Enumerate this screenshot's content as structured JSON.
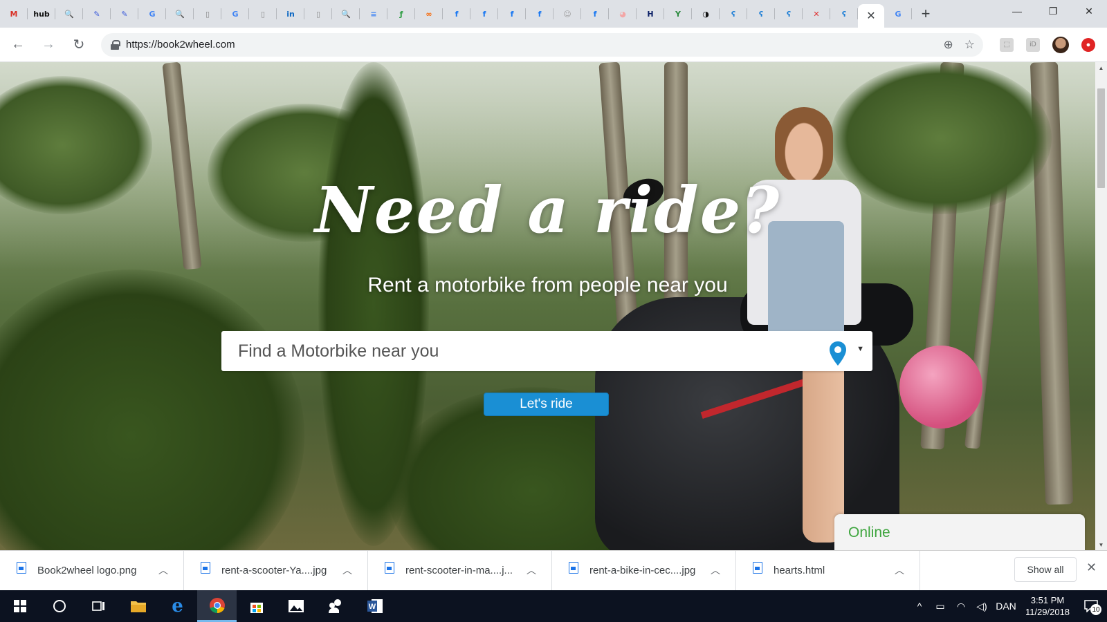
{
  "browser": {
    "tabs": [
      {
        "icon": "gmail-icon",
        "glyph": "M",
        "color": "#d93025"
      },
      {
        "icon": "hub-icon",
        "glyph": "hub",
        "color": "#111111"
      },
      {
        "icon": "search-magnifier-icon",
        "glyph": "🔍",
        "color": "#4a6fd8"
      },
      {
        "icon": "form-icon",
        "glyph": "✎",
        "color": "#3b5bdb"
      },
      {
        "icon": "form-icon",
        "glyph": "✎",
        "color": "#3b5bdb"
      },
      {
        "icon": "google-icon",
        "glyph": "G",
        "color": "#4285f4"
      },
      {
        "icon": "search-magnifier-icon",
        "glyph": "🔍",
        "color": "#4a6fd8"
      },
      {
        "icon": "document-icon",
        "glyph": "▯",
        "color": "#888888"
      },
      {
        "icon": "google-icon",
        "glyph": "G",
        "color": "#4285f4"
      },
      {
        "icon": "document-icon",
        "glyph": "▯",
        "color": "#888888"
      },
      {
        "icon": "linkedin-icon",
        "glyph": "in",
        "color": "#0a66c2"
      },
      {
        "icon": "document-icon",
        "glyph": "▯",
        "color": "#888888"
      },
      {
        "icon": "search-magnifier-icon",
        "glyph": "🔍",
        "color": "#4a6fd8"
      },
      {
        "icon": "docs-icon",
        "glyph": "≡",
        "color": "#4285f4"
      },
      {
        "icon": "feather-icon",
        "glyph": "ƒ",
        "color": "#2f9e44"
      },
      {
        "icon": "link-icon",
        "glyph": "∞",
        "color": "#f76707"
      },
      {
        "icon": "facebook-icon",
        "glyph": "f",
        "color": "#1877f2"
      },
      {
        "icon": "facebook-icon",
        "glyph": "f",
        "color": "#1877f2"
      },
      {
        "icon": "facebook-icon",
        "glyph": "f",
        "color": "#1877f2"
      },
      {
        "icon": "facebook-icon",
        "glyph": "f",
        "color": "#1877f2"
      },
      {
        "icon": "profile-icon",
        "glyph": "☺",
        "color": "#9e9e9e"
      },
      {
        "icon": "facebook-icon",
        "glyph": "f",
        "color": "#1877f2"
      },
      {
        "icon": "pig-icon",
        "glyph": "◕",
        "color": "#f3a6a6"
      },
      {
        "icon": "h-icon",
        "glyph": "H",
        "color": "#0b1f66"
      },
      {
        "icon": "plant-icon",
        "glyph": "Y",
        "color": "#2b8a3e"
      },
      {
        "icon": "swirl-icon",
        "glyph": "◑",
        "color": "#111111"
      },
      {
        "icon": "cyan-swoosh-icon",
        "glyph": "ʕ",
        "color": "#1c7ed6"
      },
      {
        "icon": "cyan-swoosh-icon",
        "glyph": "ʕ",
        "color": "#1c7ed6"
      },
      {
        "icon": "cyan-swoosh-icon",
        "glyph": "ʕ",
        "color": "#1c7ed6"
      },
      {
        "icon": "x-logo-icon",
        "glyph": "✕",
        "color": "#e03131"
      },
      {
        "icon": "cyan-swoosh-icon",
        "glyph": "ʕ",
        "color": "#1c7ed6"
      }
    ],
    "active_tab_close": "✕",
    "after_tab_icon": {
      "icon": "google-icon",
      "glyph": "G",
      "color": "#4285f4"
    },
    "new_tab": "+",
    "window_controls": {
      "minimize": "—",
      "restore": "❐",
      "close": "✕"
    },
    "url": "https://book2wheel.com"
  },
  "hero": {
    "title": "Need a ride?",
    "subtitle": "Rent a motorbike from people near you",
    "search_placeholder": "Find a Motorbike near you",
    "button": "Let's ride",
    "chat_status": "Online",
    "accent": "#1a8fd4",
    "online_color": "#3ea53e"
  },
  "downloads": {
    "items": [
      {
        "name": "Book2wheel logo.png"
      },
      {
        "name": "rent-a-scooter-Ya....jpg"
      },
      {
        "name": "rent-scooter-in-ma....j..."
      },
      {
        "name": "rent-a-bike-in-cec....jpg"
      },
      {
        "name": "hearts.html"
      }
    ],
    "show_all": "Show all",
    "close": "✕"
  },
  "taskbar": {
    "language": "DAN",
    "time": "3:51 PM",
    "date": "11/29/2018",
    "notification_count": "10"
  }
}
